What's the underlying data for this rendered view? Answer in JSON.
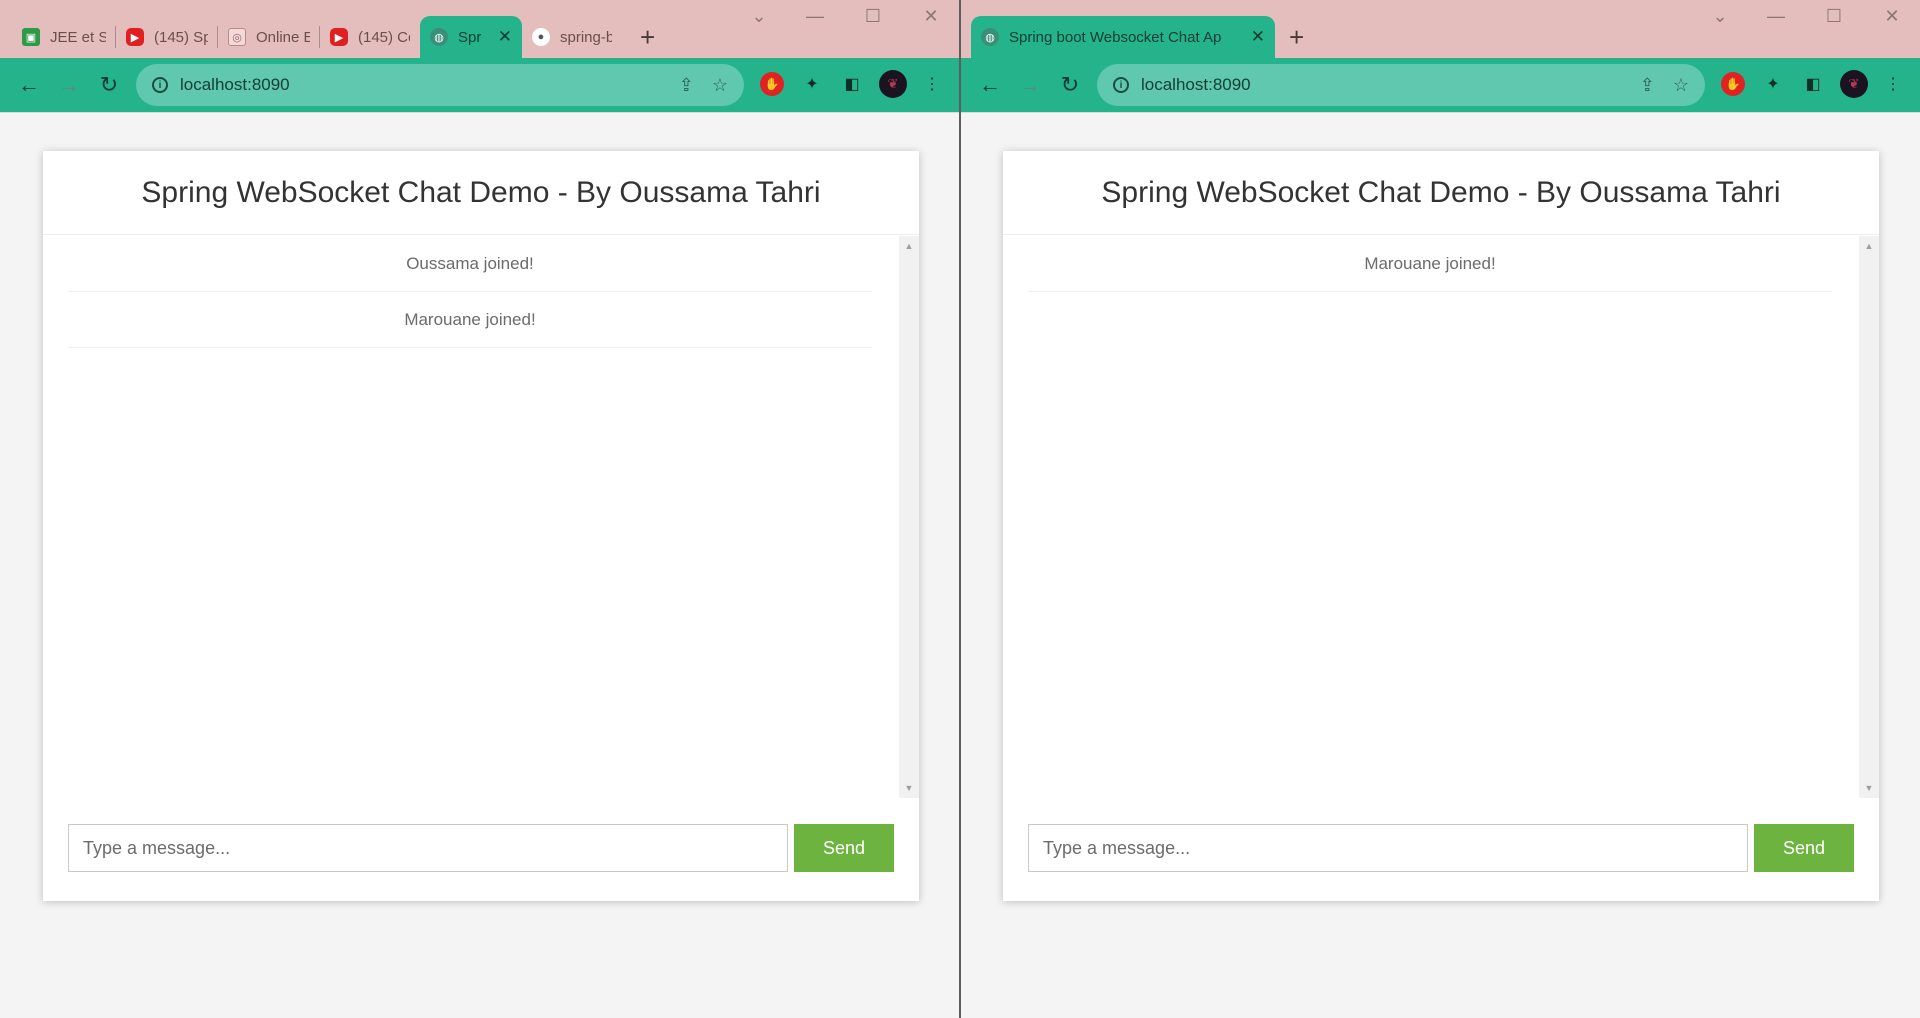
{
  "left_window": {
    "tabs": [
      {
        "title": "JEE et S",
        "favicon": "classroom-icon",
        "color": "#2e9a48"
      },
      {
        "title": "(145) Sp",
        "favicon": "youtube-icon",
        "color": "#e02020"
      },
      {
        "title": "Online E",
        "favicon": "page-icon",
        "color": "#d9a3a3"
      },
      {
        "title": "(145) Co",
        "favicon": "youtube-icon",
        "color": "#e02020"
      },
      {
        "title": "Spr",
        "favicon": "globe-icon",
        "color": "#3a8f78",
        "active": true
      },
      {
        "title": "spring-b",
        "favicon": "github-icon",
        "color": "#ffffff"
      }
    ],
    "url": "localhost:8090",
    "page": {
      "title": "Spring WebSocket Chat Demo - By Oussama Tahri",
      "events": [
        "Oussama joined!",
        "Marouane joined!"
      ],
      "input_placeholder": "Type a message...",
      "send_label": "Send"
    }
  },
  "right_window": {
    "tabs": [
      {
        "title": "Spring boot Websocket Chat Ap",
        "favicon": "globe-icon",
        "color": "#3a8f78",
        "active": true
      }
    ],
    "url": "localhost:8090",
    "page": {
      "title": "Spring WebSocket Chat Demo - By Oussama Tahri",
      "events": [
        "Marouane joined!"
      ],
      "input_placeholder": "Type a message...",
      "send_label": "Send"
    }
  },
  "theme": {
    "tabstrip": "#e4bdbd",
    "toolbar": "#24b38a",
    "send_button": "#6db33f"
  }
}
